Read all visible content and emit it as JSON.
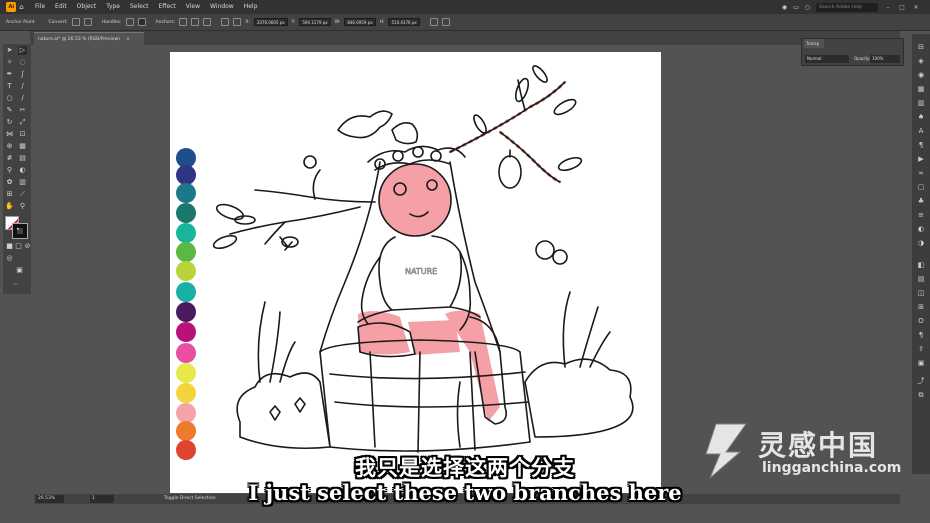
{
  "app": {
    "logo_label": "Ai",
    "menu": [
      "File",
      "Edit",
      "Object",
      "Type",
      "Select",
      "Effect",
      "View",
      "Window",
      "Help"
    ],
    "search_placeholder": "Search Adobe Help"
  },
  "controlbar": {
    "tool_name": "Anchor Point",
    "convert_label": "Convert:",
    "handles_label": "Handles:",
    "anchors_label": "Anchors:",
    "x_value": "2076.0605 px",
    "y_value": "594.1179 px",
    "w_value": "846.6959 px",
    "h_value": "510.4376 px"
  },
  "document": {
    "tab_title": "nature.ai* @ 26.53 % (RGB/Preview)",
    "close_glyph": "×"
  },
  "swatches": [
    "#1f4e8c",
    "#2f3580",
    "#1b7a8a",
    "#17786b",
    "#18b59a",
    "#5cb840",
    "#b8d43a",
    "#19b0a6",
    "#4a1a5c",
    "#b8127a",
    "#e84fa3",
    "#e8e84a",
    "#f2d43c",
    "#f4a3a8",
    "#ee7a2e",
    "#e04430"
  ],
  "panel": {
    "tab_label": "Transp",
    "blend_mode": "Normal",
    "opacity_label": "Opacity:",
    "opacity_value": "100%"
  },
  "status": {
    "zoom": "26.53%",
    "page": "1",
    "status_text": "Toggle Direct Selection"
  },
  "subtitles": {
    "cn": "我只是选择这两个分支",
    "en": "I just select these two branches here"
  },
  "watermark": {
    "cn": "灵感中国",
    "en": "lingganchina.com"
  },
  "colors": {
    "pink_fill": "#f4a0a6",
    "line": "#1a1a1a",
    "branch_highlight": "#c0392b"
  }
}
